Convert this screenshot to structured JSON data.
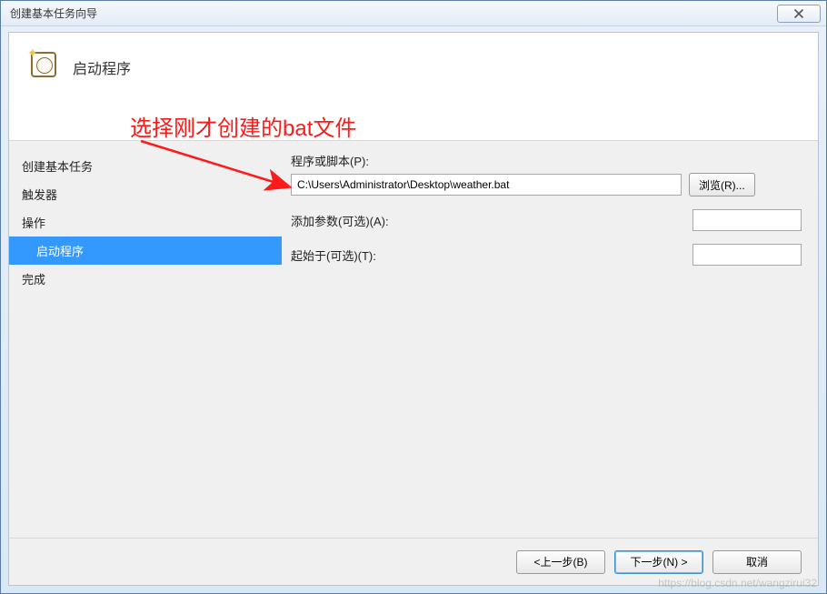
{
  "window": {
    "title": "创建基本任务向导"
  },
  "header": {
    "title": "启动程序"
  },
  "sidebar": {
    "items": [
      {
        "label": "创建基本任务",
        "indent": false,
        "selected": false
      },
      {
        "label": "触发器",
        "indent": false,
        "selected": false
      },
      {
        "label": "操作",
        "indent": false,
        "selected": false
      },
      {
        "label": "启动程序",
        "indent": true,
        "selected": true
      },
      {
        "label": "完成",
        "indent": false,
        "selected": false
      }
    ]
  },
  "form": {
    "program_label": "程序或脚本(P):",
    "program_value": "C:\\Users\\Administrator\\Desktop\\weather.bat",
    "browse_label": "浏览(R)...",
    "args_label": "添加参数(可选)(A):",
    "args_value": "",
    "startin_label": "起始于(可选)(T):",
    "startin_value": ""
  },
  "buttons": {
    "back": "<上一步(B)",
    "next": "下一步(N) >",
    "cancel": "取消"
  },
  "annotation": {
    "text": "选择刚才创建的bat文件"
  },
  "watermark": "https://blog.csdn.net/wangzirui32"
}
